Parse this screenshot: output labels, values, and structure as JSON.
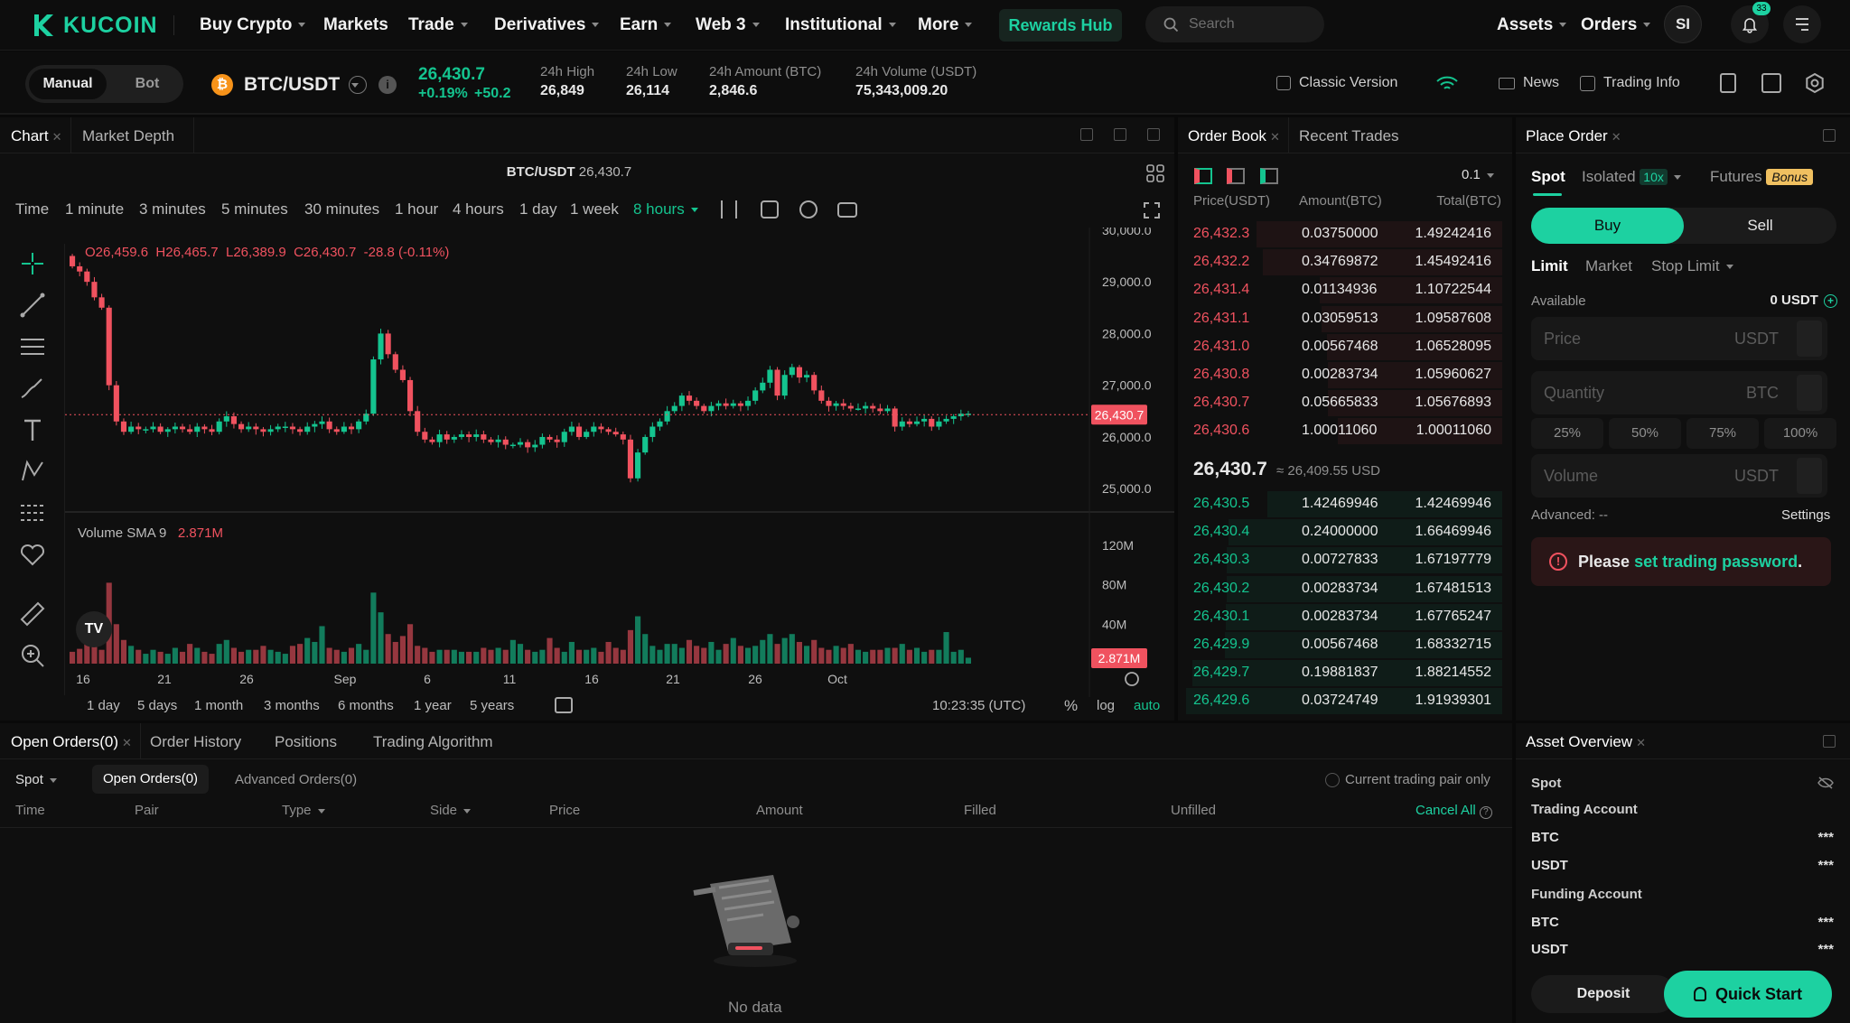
{
  "brand": {
    "logo_text": "KUCOIN",
    "accent": "#1dd1a1",
    "up": "#14c48f",
    "down": "#f0525f"
  },
  "nav": {
    "items": [
      "Buy Crypto",
      "Markets",
      "Trade",
      "Derivatives",
      "Earn",
      "Web 3",
      "Institutional",
      "More"
    ],
    "rewards": "Rewards Hub",
    "search_placeholder": "Search",
    "assets": "Assets",
    "orders": "Orders",
    "avatar": "SI",
    "notif_count": "33"
  },
  "mode": {
    "manual": "Manual",
    "bot": "Bot"
  },
  "pair": {
    "symbol": "BTC/USDT",
    "price": "26,430.7",
    "change_pct": "+0.19%",
    "change_abs": "+50.2",
    "stats": [
      {
        "label": "24h High",
        "value": "26,849"
      },
      {
        "label": "24h Low",
        "value": "26,114"
      },
      {
        "label": "24h Amount (BTC)",
        "value": "2,846.6"
      },
      {
        "label": "24h Volume (USDT)",
        "value": "75,343,009.20"
      }
    ]
  },
  "topright": {
    "classic": "Classic Version",
    "news": "News",
    "trading_info": "Trading Info"
  },
  "chart_tabs": {
    "chart": "Chart",
    "depth": "Market Depth"
  },
  "chart_header": {
    "pair": "BTC/USDT",
    "price": "26,430.7"
  },
  "intervals": [
    "Time",
    "1 minute",
    "3 minutes",
    "5 minutes",
    "30 minutes",
    "1 hour",
    "4 hours",
    "1 day",
    "1 week",
    "8 hours"
  ],
  "ohlc": {
    "o": "O26,459.6",
    "h": "H26,465.7",
    "l": "L26,389.9",
    "c": "C26,430.7",
    "chg": "-28.8 (-0.11%)"
  },
  "volume_label": {
    "name": "Volume SMA 9",
    "value": "2.871M"
  },
  "price_tag": "26,430.7",
  "vol_tag": "2.871M",
  "ranges": [
    "1 day",
    "5 days",
    "1 month",
    "3 months",
    "6 months",
    "1 year",
    "5 years"
  ],
  "chart_footer": {
    "time": "10:23:35 (UTC)",
    "pct": "%",
    "log": "log",
    "auto": "auto"
  },
  "chart_data": {
    "type": "candlestick",
    "title": "BTC/USDT",
    "xlabel": "",
    "ylabel": "",
    "y_ticks": [
      "30,000.0",
      "29,000.0",
      "28,000.0",
      "27,000.0",
      "26,000.0",
      "25,000.0"
    ],
    "vol_ticks": [
      "120M",
      "80M",
      "40M"
    ],
    "x_ticks": [
      "16",
      "21",
      "26",
      "Sep",
      "6",
      "11",
      "16",
      "21",
      "26",
      "Oct"
    ],
    "ylim": [
      24550,
      30050
    ],
    "vol_max": 140,
    "close": [
      29300,
      29200,
      29000,
      28700,
      28500,
      27000,
      26300,
      26100,
      26200,
      26150,
      26150,
      26200,
      26100,
      26150,
      26200,
      26150,
      26100,
      26200,
      26150,
      26100,
      26300,
      26400,
      26250,
      26150,
      26200,
      26150,
      26100,
      26150,
      26200,
      26200,
      26150,
      26100,
      26200,
      26250,
      26300,
      26150,
      26100,
      26200,
      26150,
      26300,
      26450,
      27500,
      28000,
      27600,
      27300,
      27100,
      26500,
      26100,
      25950,
      25900,
      26050,
      25950,
      26000,
      26050,
      26000,
      26050,
      25950,
      25900,
      25950,
      25850,
      25850,
      25900,
      25800,
      25850,
      26000,
      25950,
      25900,
      26100,
      26200,
      26000,
      26100,
      26200,
      26150,
      26100,
      26050,
      25950,
      25200,
      25700,
      26000,
      26200,
      26300,
      26500,
      26600,
      26800,
      26700,
      26600,
      26500,
      26600,
      26650,
      26600,
      26650,
      26600,
      26700,
      26900,
      27050,
      27300,
      26800,
      27200,
      27350,
      27150,
      27200,
      26900,
      26700,
      26600,
      26650,
      26600,
      26550,
      26550,
      26600,
      26550,
      26500,
      26550,
      26200,
      26300,
      26250,
      26300,
      26350,
      26200,
      26300,
      26350,
      26400,
      26450,
      26450
    ],
    "volume": [
      12,
      15,
      20,
      34,
      14,
      82,
      40,
      24,
      18,
      14,
      10,
      14,
      12,
      10,
      16,
      12,
      20,
      16,
      12,
      10,
      20,
      24,
      16,
      12,
      14,
      14,
      18,
      14,
      12,
      10,
      18,
      20,
      26,
      22,
      38,
      16,
      14,
      12,
      16,
      20,
      14,
      72,
      52,
      30,
      22,
      28,
      40,
      18,
      16,
      12,
      14,
      14,
      14,
      12,
      12,
      12,
      16,
      14,
      16,
      14,
      24,
      20,
      14,
      12,
      14,
      26,
      16,
      12,
      22,
      14,
      14,
      16,
      12,
      22,
      16,
      14,
      34,
      48,
      30,
      18,
      14,
      20,
      20,
      16,
      24,
      18,
      16,
      22,
      14,
      20,
      26,
      18,
      16,
      18,
      24,
      30,
      20,
      26,
      30,
      22,
      18,
      24,
      16,
      14,
      18,
      16,
      20,
      14,
      12,
      14,
      14,
      16,
      16,
      20,
      14,
      16,
      12,
      14,
      14,
      32,
      12,
      14,
      6
    ]
  },
  "orderbook": {
    "tabs": [
      "Order Book",
      "Recent Trades"
    ],
    "precision": "0.1",
    "headers": [
      "Price(USDT)",
      "Amount(BTC)",
      "Total(BTC)"
    ],
    "asks": [
      [
        "26,432.3",
        "0.03750000",
        "1.49242416"
      ],
      [
        "26,432.2",
        "0.34769872",
        "1.45492416"
      ],
      [
        "26,431.4",
        "0.01134936",
        "1.10722544"
      ],
      [
        "26,431.1",
        "0.03059513",
        "1.09587608"
      ],
      [
        "26,431.0",
        "0.00567468",
        "1.06528095"
      ],
      [
        "26,430.8",
        "0.00283734",
        "1.05960627"
      ],
      [
        "26,430.7",
        "0.05665833",
        "1.05676893"
      ],
      [
        "26,430.6",
        "1.00011060",
        "1.00011060"
      ]
    ],
    "mid_price": "26,430.7",
    "mid_usd": "≈ 26,409.55 USD",
    "bids": [
      [
        "26,430.5",
        "1.42469946",
        "1.42469946"
      ],
      [
        "26,430.4",
        "0.24000000",
        "1.66469946"
      ],
      [
        "26,430.3",
        "0.00727833",
        "1.67197779"
      ],
      [
        "26,430.2",
        "0.00283734",
        "1.67481513"
      ],
      [
        "26,430.1",
        "0.00283734",
        "1.67765247"
      ],
      [
        "26,429.9",
        "0.00567468",
        "1.68332715"
      ],
      [
        "26,429.7",
        "0.19881837",
        "1.88214552"
      ],
      [
        "26,429.6",
        "0.03724749",
        "1.91939301"
      ]
    ]
  },
  "place_order": {
    "title": "Place Order",
    "types": {
      "spot": "Spot",
      "isolated": "Isolated",
      "leverage": "10x",
      "futures": "Futures",
      "bonus": "Bonus"
    },
    "buy": "Buy",
    "sell": "Sell",
    "modes": {
      "limit": "Limit",
      "market": "Market",
      "stop": "Stop Limit"
    },
    "available_label": "Available",
    "available_value": "0 USDT",
    "price_ph": "Price",
    "price_unit": "USDT",
    "qty_ph": "Quantity",
    "qty_unit": "BTC",
    "pcts": [
      "25%",
      "50%",
      "75%",
      "100%"
    ],
    "volume_ph": "Volume",
    "volume_unit": "USDT",
    "advanced": "Advanced: --",
    "settings": "Settings",
    "notice_pre": "Please ",
    "notice_link": "set trading password",
    "notice_post": "."
  },
  "orders": {
    "tabs": [
      "Open Orders(0)",
      "Order History",
      "Positions",
      "Trading Algorithm"
    ],
    "filter": "Spot",
    "subtabs": [
      "Open Orders(0)",
      "Advanced Orders(0)"
    ],
    "current_pair": "Current trading pair only",
    "headers": [
      "Time",
      "Pair",
      "Type",
      "Side",
      "Price",
      "Amount",
      "Filled",
      "Unfilled"
    ],
    "cancel_all": "Cancel All",
    "empty": "No data"
  },
  "asset_overview": {
    "title": "Asset Overview",
    "spot": "Spot",
    "trading_account": "Trading Account",
    "funding_account": "Funding Account",
    "rows": [
      "BTC",
      "USDT",
      "BTC",
      "USDT"
    ],
    "masked": "***",
    "deposit": "Deposit",
    "quick_start": "Quick Start"
  }
}
